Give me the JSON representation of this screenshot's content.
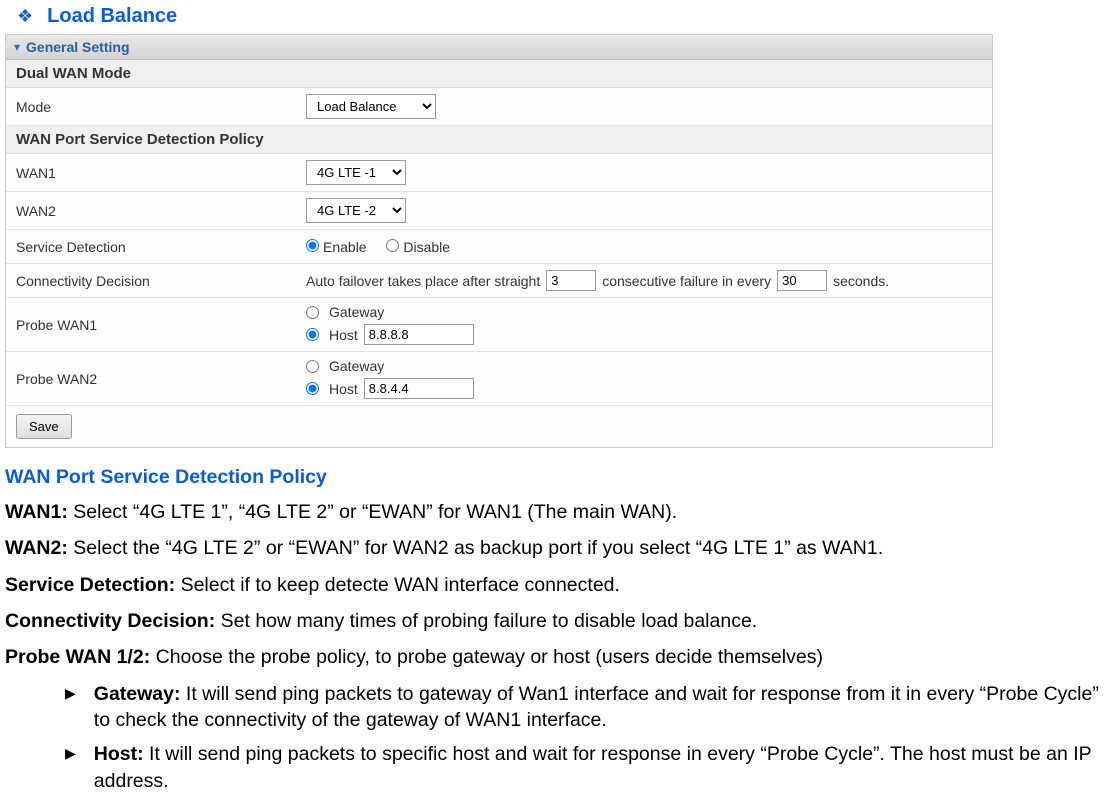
{
  "title": {
    "label": "Load Balance"
  },
  "panel": {
    "general_setting": "General Setting",
    "dual_wan_mode": "Dual WAN Mode",
    "mode_label": "Mode",
    "mode_value": "Load Balance",
    "policy_header": "WAN Port Service Detection Policy",
    "wan1_label": "WAN1",
    "wan1_value": "4G LTE -1",
    "wan2_label": "WAN2",
    "wan2_value": "4G LTE -2",
    "service_detection_label": "Service Detection",
    "enable_label": "Enable",
    "disable_label": "Disable",
    "connectivity_label": "Connectivity Decision",
    "conn_text_1": "Auto failover takes place after straight",
    "conn_val_1": "3",
    "conn_text_2": "consecutive failure in every",
    "conn_val_2": "30",
    "conn_text_3": "seconds.",
    "probe_wan1_label": "Probe WAN1",
    "probe_wan2_label": "Probe WAN2",
    "gateway_label": "Gateway",
    "host_label": "Host",
    "host1_value": "8.8.8.8",
    "host2_value": "8.8.4.4",
    "save_btn": "Save"
  },
  "desc": {
    "heading": "WAN Port Service Detection Policy",
    "wan1_b": "WAN1:",
    "wan1_t": " Select “4G LTE 1”, “4G LTE 2” or “EWAN” for WAN1 (The main WAN).",
    "wan2_b": "WAN2:",
    "wan2_t": " Select the “4G LTE 2” or “EWAN” for WAN2 as backup port if you select “4G LTE 1” as WAN1.",
    "sd_b": "Service Detection:",
    "sd_t": " Select if to keep detecte WAN interface connected.",
    "cd_b": "Connectivity Decision:",
    "cd_t": " Set how many times of probing failure to disable load balance.",
    "pw_b": "Probe WAN 1/2:",
    "pw_t": " Choose the probe policy, to probe gateway or host (users decide themselves)",
    "gw_b": "Gateway:",
    "gw_t": " It will send ping packets to gateway of Wan1 interface and wait for response from it in every “Probe Cycle” to check the connectivity of the gateway of WAN1 interface.",
    "host_b": "Host:",
    "host_t": " It will send ping packets to specific host and wait for response in every “Probe Cycle”. The host must be an IP address."
  }
}
